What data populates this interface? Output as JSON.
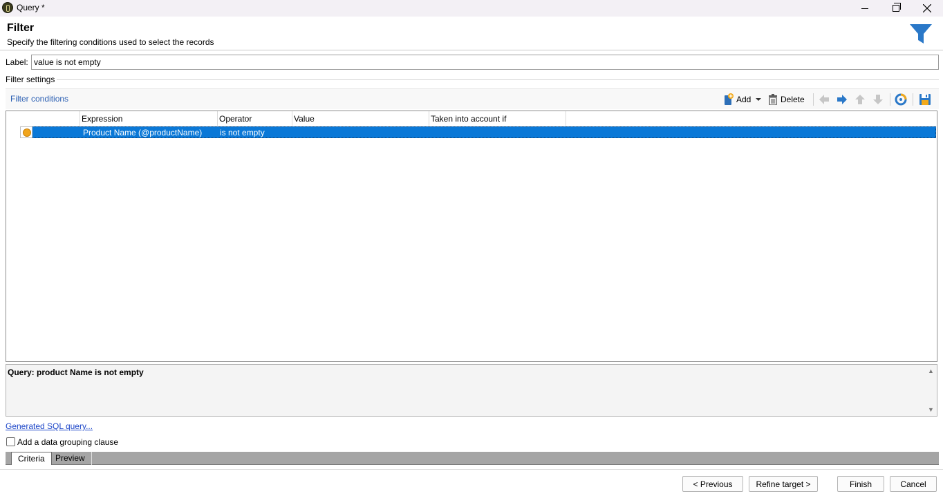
{
  "window": {
    "title": "Query *"
  },
  "header": {
    "title": "Filter",
    "subtitle": "Specify the filtering conditions used to select the records"
  },
  "label_field": {
    "label": "Label:",
    "value": "value is not empty"
  },
  "filter_settings": {
    "title": "Filter settings"
  },
  "toolbar": {
    "filter_conditions": "Filter conditions",
    "add_label": "Add",
    "delete_label": "Delete"
  },
  "grid": {
    "columns": [
      "Expression",
      "Operator",
      "Value",
      "Taken into account if"
    ],
    "rows": [
      {
        "expression": "Product Name (@productName)",
        "operator": "is not empty",
        "value": "",
        "taken_into_account_if": ""
      }
    ],
    "selection_color": "#0a78d7"
  },
  "query": {
    "text": "Query: product Name is not empty"
  },
  "sql_link": "Generated SQL query...",
  "grouping": {
    "label": "Add a data grouping clause",
    "checked": false
  },
  "tabs": [
    "Criteria",
    "Preview"
  ],
  "buttons": {
    "previous": "< Previous",
    "refine": "Refine target >",
    "finish": "Finish",
    "cancel": "Cancel"
  },
  "icons": {
    "funnel": "funnel-icon",
    "add": "add-icon",
    "delete": "trash-icon",
    "left": "arrow-left-icon",
    "right": "arrow-right-icon",
    "up": "arrow-up-icon",
    "down": "arrow-down-icon",
    "refresh": "refresh-icon",
    "save": "save-icon"
  }
}
